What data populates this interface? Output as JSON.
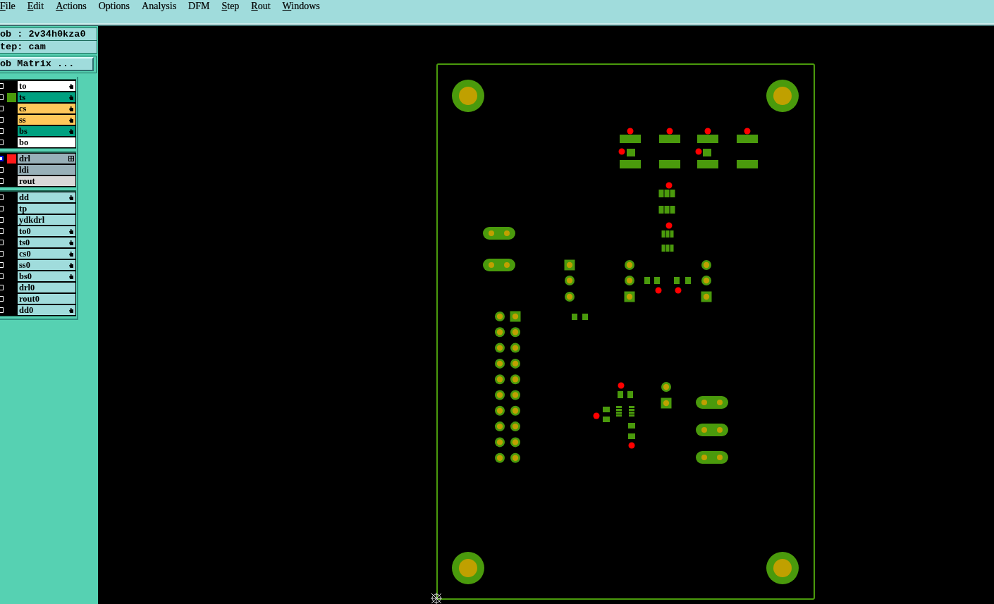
{
  "menu_bar": [
    {
      "label": "File",
      "underline_first": true
    },
    {
      "label": "Edit",
      "underline_first": true
    },
    {
      "label": "Actions",
      "underline_first": true
    },
    {
      "label": "Options",
      "underline_first": false
    },
    {
      "label": "Analysis",
      "underline_first": false
    },
    {
      "label": "DFM",
      "underline_first": false
    },
    {
      "label": "Step",
      "underline_first": true
    },
    {
      "label": "Rout",
      "underline_first": true
    },
    {
      "label": "Windows",
      "underline_first": true
    }
  ],
  "job_info": [
    "ob : 2v34h0kza0",
    "tep: cam"
  ],
  "job_matrix_button": "ob Matrix ...",
  "layer_groups": [
    [
      {
        "name": "to",
        "color": "#ffffff",
        "displayed": false,
        "selected": false,
        "kind": "hand"
      },
      {
        "name": "ts",
        "color": "#00a080",
        "displayed": true,
        "display": {
          "color": "#4a9a0c"
        },
        "selected": false,
        "kind": "hand"
      },
      {
        "name": "cs",
        "color": "#ffc85a",
        "displayed": false,
        "selected": false,
        "kind": "hand"
      },
      {
        "name": "ss",
        "color": "#ffc85a",
        "displayed": false,
        "selected": false,
        "kind": "hand"
      },
      {
        "name": "bs",
        "color": "#00a080",
        "displayed": false,
        "selected": false,
        "kind": "hand"
      },
      {
        "name": "bo",
        "color": "#ffffff",
        "displayed": false,
        "selected": false,
        "kind": "plain"
      }
    ],
    [
      {
        "name": "drl",
        "color": "#98b0b8",
        "displayed": true,
        "display": {
          "color": "#ff1a1a"
        },
        "selected": true,
        "kind": "grid"
      },
      {
        "name": "ldi",
        "color": "#98b0b8",
        "displayed": false,
        "selected": false,
        "kind": "plain"
      },
      {
        "name": "rout",
        "color": "#d8d8d8",
        "displayed": false,
        "selected": false,
        "kind": "plain"
      }
    ],
    [
      {
        "name": "dd",
        "color": "#a0dcdc",
        "displayed": false,
        "selected": false,
        "kind": "hand"
      },
      {
        "name": "tp",
        "color": "#a0dcdc",
        "displayed": false,
        "selected": false,
        "kind": "plain"
      },
      {
        "name": "ydkdrl",
        "color": "#a0dcdc",
        "displayed": false,
        "selected": false,
        "kind": "plain"
      },
      {
        "name": "to0",
        "color": "#a0dcdc",
        "displayed": false,
        "selected": false,
        "kind": "hand"
      },
      {
        "name": "ts0",
        "color": "#a0dcdc",
        "displayed": false,
        "selected": false,
        "kind": "hand"
      },
      {
        "name": "cs0",
        "color": "#a0dcdc",
        "displayed": false,
        "selected": false,
        "kind": "hand"
      },
      {
        "name": "ss0",
        "color": "#a0dcdc",
        "displayed": false,
        "selected": false,
        "kind": "hand"
      },
      {
        "name": "bs0",
        "color": "#a0dcdc",
        "displayed": false,
        "selected": false,
        "kind": "hand"
      },
      {
        "name": "drl0",
        "color": "#a0dcdc",
        "displayed": false,
        "selected": false,
        "kind": "plain"
      },
      {
        "name": "rout0",
        "color": "#a0dcdc",
        "displayed": false,
        "selected": false,
        "kind": "plain"
      },
      {
        "name": "dd0",
        "color": "#a0dcdc",
        "displayed": false,
        "selected": false,
        "kind": "hand"
      }
    ]
  ]
}
